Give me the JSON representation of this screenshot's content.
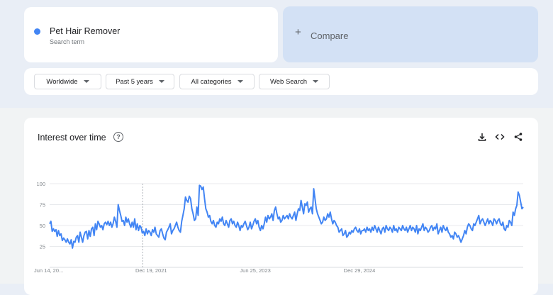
{
  "search_term": {
    "name": "Pet Hair Remover",
    "subtitle": "Search term",
    "color": "#4285f4"
  },
  "compare": {
    "label": "Compare",
    "icon": "plus-icon"
  },
  "filters": {
    "region": "Worldwide",
    "time": "Past 5 years",
    "category": "All categories",
    "search_type": "Web Search"
  },
  "chart_header": {
    "title": "Interest over time",
    "help_icon": "help-circle-icon",
    "actions": [
      "download-icon",
      "embed-code-icon",
      "share-icon"
    ]
  },
  "colors": {
    "series": "#4285f4",
    "accent": "#1a73e8"
  },
  "chart_data": {
    "type": "line",
    "title": "Interest over time",
    "xlabel": "",
    "ylabel": "",
    "ylim": [
      0,
      100
    ],
    "yticks": [
      25,
      50,
      75,
      100
    ],
    "x_tick_labels": [
      "Jun 14, 20...",
      "Dec 19, 2021",
      "Jun 25, 2023",
      "Dec 29, 2024"
    ],
    "x_tick_index": [
      0,
      80,
      162,
      244
    ],
    "grid": true,
    "legend": "none",
    "series": [
      {
        "name": "Pet Hair Remover",
        "values": [
          52,
          55,
          43,
          46,
          43,
          45,
          37,
          44,
          38,
          40,
          32,
          35,
          33,
          30,
          34,
          30,
          28,
          33,
          23,
          31,
          30,
          36,
          38,
          30,
          42,
          36,
          30,
          38,
          42,
          43,
          34,
          44,
          37,
          46,
          48,
          38,
          52,
          45,
          55,
          52,
          48,
          50,
          45,
          52,
          54,
          51,
          55,
          50,
          54,
          48,
          52,
          60,
          55,
          48,
          75,
          68,
          62,
          55,
          56,
          50,
          60,
          54,
          58,
          52,
          48,
          54,
          48,
          58,
          45,
          52,
          44,
          50,
          48,
          41,
          43,
          38,
          46,
          40,
          44,
          42,
          38,
          45,
          42,
          48,
          40,
          38,
          36,
          44,
          46,
          40,
          35,
          33,
          42,
          45,
          48,
          52,
          40,
          44,
          46,
          50,
          54,
          48,
          44,
          42,
          55,
          62,
          70,
          84,
          80,
          78,
          85,
          82,
          70,
          64,
          56,
          58,
          72,
          62,
          98,
          97,
          93,
          96,
          82,
          70,
          66,
          60,
          62,
          55,
          52,
          56,
          50,
          48,
          54,
          52,
          58,
          55,
          60,
          52,
          50,
          56,
          52,
          48,
          56,
          58,
          52,
          55,
          50,
          48,
          54,
          50,
          44,
          50,
          48,
          52,
          55,
          50,
          45,
          48,
          54,
          46,
          50,
          55,
          58,
          52,
          56,
          48,
          44,
          50,
          46,
          52,
          60,
          54,
          62,
          58,
          60,
          64,
          56,
          68,
          72,
          64,
          58,
          60,
          54,
          56,
          62,
          58,
          60,
          62,
          58,
          64,
          60,
          58,
          62,
          66,
          56,
          64,
          70,
          68,
          80,
          72,
          64,
          76,
          74,
          78,
          66,
          70,
          72,
          64,
          94,
          82,
          70,
          64,
          60,
          56,
          52,
          54,
          60,
          56,
          58,
          64,
          60,
          66,
          58,
          52,
          56,
          54,
          50,
          48,
          42,
          44,
          46,
          38,
          40,
          44,
          36,
          38,
          42,
          40,
          44,
          42,
          46,
          48,
          44,
          42,
          46,
          40,
          44,
          44,
          46,
          42,
          48,
          44,
          46,
          42,
          48,
          44,
          50,
          46,
          42,
          48,
          44,
          40,
          46,
          48,
          42,
          50,
          46,
          44,
          48,
          46,
          42,
          50,
          44,
          46,
          42,
          48,
          46,
          44,
          50,
          46,
          44,
          48,
          42,
          46,
          50,
          44,
          48,
          46,
          42,
          50,
          40,
          46,
          44,
          48,
          52,
          44,
          48,
          46,
          42,
          44,
          48,
          50,
          44,
          48,
          46,
          52,
          40,
          44,
          48,
          42,
          50,
          46,
          44,
          48,
          42,
          40,
          36,
          38,
          34,
          42,
          40,
          36,
          38,
          34,
          30,
          34,
          38,
          44,
          40,
          48,
          52,
          50,
          46,
          44,
          52,
          50,
          54,
          58,
          62,
          52,
          56,
          58,
          54,
          50,
          54,
          58,
          52,
          56,
          54,
          50,
          58,
          56,
          52,
          56,
          58,
          52,
          50,
          54,
          46,
          44,
          50,
          48,
          56,
          54,
          50,
          66,
          62,
          70,
          74,
          90,
          86,
          78,
          70,
          72
        ]
      }
    ]
  }
}
